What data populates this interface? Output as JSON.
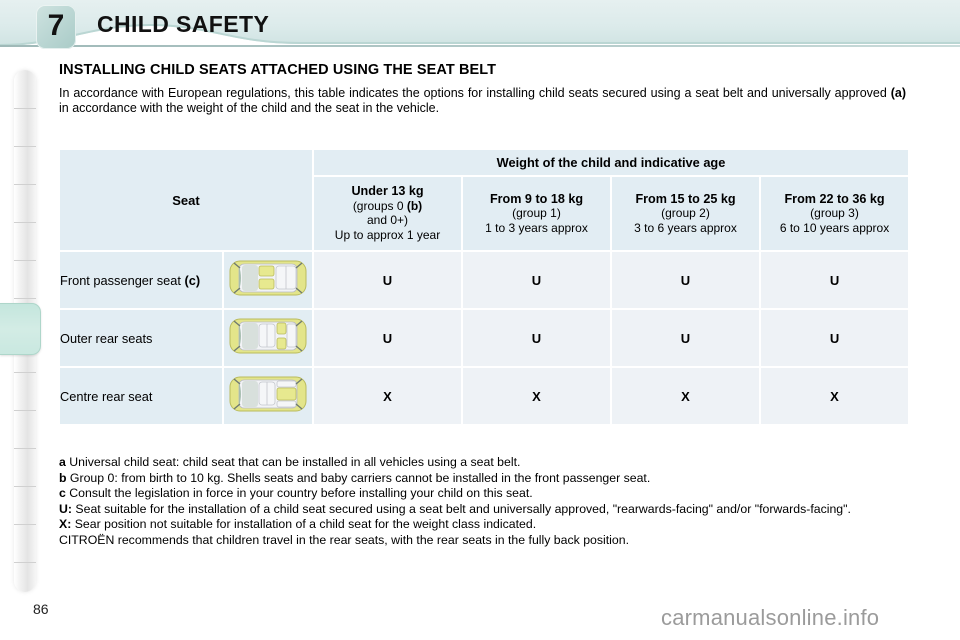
{
  "header": {
    "chapter_number": "7",
    "chapter_title": "CHILD SAFETY"
  },
  "section": {
    "title": "INSTALLING CHILD SEATS ATTACHED USING THE SEAT BELT",
    "intro_part1": "In accordance with European regulations, this table indicates the options for installing child seats secured using a seat belt and universally approved ",
    "intro_bold": "(a)",
    "intro_part2": " in accordance with the weight of the child and the seat in the vehicle."
  },
  "table": {
    "seat_header": "Seat",
    "weight_header": "Weight of the child and indicative age",
    "columns": [
      {
        "line1": "Under 13 kg",
        "line2_pre": "(groups 0 ",
        "line2_bold": "(b)",
        "line3": "and 0+)",
        "line4": "Up to approx 1 year"
      },
      {
        "line1": "From 9 to 18 kg",
        "line2_pre": "(group 1)",
        "line2_bold": "",
        "line3": "",
        "line4": "1 to 3 years approx"
      },
      {
        "line1": "From 15 to 25 kg",
        "line2_pre": "(group 2)",
        "line2_bold": "",
        "line3": "",
        "line4": "3 to 6 years approx"
      },
      {
        "line1": "From 22 to 36 kg",
        "line2_pre": "(group 3)",
        "line2_bold": "",
        "line3": "",
        "line4": "6 to 10 years approx"
      }
    ],
    "rows": [
      {
        "label_text": "Front passenger seat ",
        "label_bold": "(c)",
        "icon": "car-top-view-front-passenger-icon",
        "values": [
          "U",
          "U",
          "U",
          "U"
        ]
      },
      {
        "label_text": "Outer rear seats",
        "label_bold": "",
        "icon": "car-top-view-outer-rear-icon",
        "values": [
          "U",
          "U",
          "U",
          "U"
        ]
      },
      {
        "label_text": "Centre rear seat",
        "label_bold": "",
        "icon": "car-top-view-centre-rear-icon",
        "values": [
          "X",
          "X",
          "X",
          "X"
        ]
      }
    ]
  },
  "notes": {
    "a_tag": "a",
    "a_text": " Universal child seat: child seat that can be installed in all vehicles using a seat belt.",
    "b_tag": "b",
    "b_text": " Group 0: from birth to 10 kg. Shells seats and baby carriers cannot be installed in the front passenger seat.",
    "c_tag": "c",
    "c_text": " Consult the legislation in force in your country before installing your child on this seat.",
    "u_tag": "U:",
    "u_text": " Seat suitable for the installation of a child seat secured using a seat belt and universally approved, \"rearwards-facing\" and/or \"forwards-facing\".",
    "x_tag": "X:",
    "x_text": " Sear position not suitable for installation of a child seat for the weight class indicated.",
    "citroen_text": "CITROËN recommends that children travel in the rear seats, with the rear seats in the fully back position."
  },
  "footer": {
    "page_number": "86",
    "watermark": "carmanualsonline.info"
  },
  "colors": {
    "header_band": "#dcebeb",
    "table_header_cell": "#e2edf3",
    "table_body_cell": "#eef2f6",
    "tab_marker": "#c9e8e0",
    "car_body": "#e3e58a"
  }
}
